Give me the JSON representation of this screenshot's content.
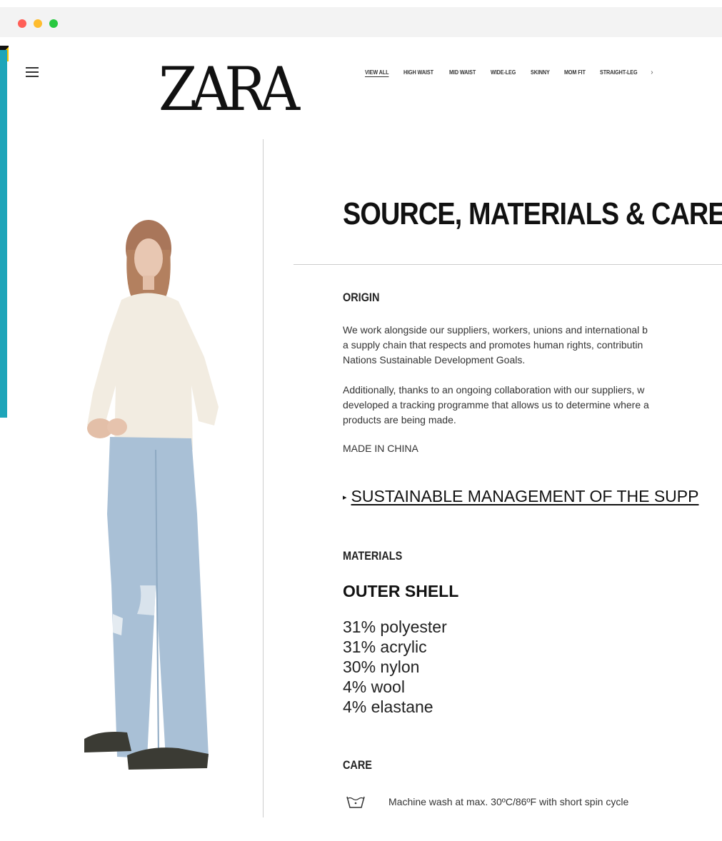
{
  "window": {
    "controls": [
      "close",
      "minimize",
      "zoom"
    ],
    "control_colors": {
      "close": "#ff5f57",
      "minimize": "#febc2e",
      "zoom": "#28c840"
    }
  },
  "header": {
    "menu_icon": "hamburger-menu-icon",
    "logo_text": "ZARA",
    "nav": {
      "items": [
        "VIEW ALL",
        "HIGH WAIST",
        "MID WAIST",
        "WIDE-LEG",
        "SKINNY",
        "MOM FIT",
        "STRAIGHT-LEG"
      ],
      "active": "VIEW ALL",
      "more_icon": "chevron-right-icon",
      "more_glyph": "›"
    }
  },
  "main": {
    "heading": "SOURCE, MATERIALS & CARE",
    "origin": {
      "label": "ORIGIN",
      "paragraph1_lines": [
        "We work alongside our suppliers, workers, unions and international b",
        "a supply chain that respects and promotes human rights, contributin",
        "Nations Sustainable Development Goals."
      ],
      "paragraph2_lines": [
        "Additionally, thanks to an ongoing collaboration with our suppliers, w",
        "developed a tracking programme that allows us to determine where a",
        "products are being made."
      ],
      "made_in": "MADE IN CHINA"
    },
    "sustainable_link": {
      "marker": "▸",
      "label": "SUSTAINABLE MANAGEMENT OF THE SUPP"
    },
    "materials": {
      "label": "MATERIALS",
      "outer_shell_label": "OUTER SHELL",
      "composition": [
        "31% polyester",
        "31% acrylic",
        "30% nylon",
        "4% wool",
        "4% elastane"
      ]
    },
    "care": {
      "label": "CARE",
      "items": [
        {
          "icon": "machine-wash-icon",
          "text": "Machine wash at max. 30ºC/86ºF with short spin cycle"
        }
      ]
    }
  },
  "colors": {
    "accent_strip": "#1ea5b9",
    "text_primary": "#111111",
    "divider": "#cccccc"
  }
}
